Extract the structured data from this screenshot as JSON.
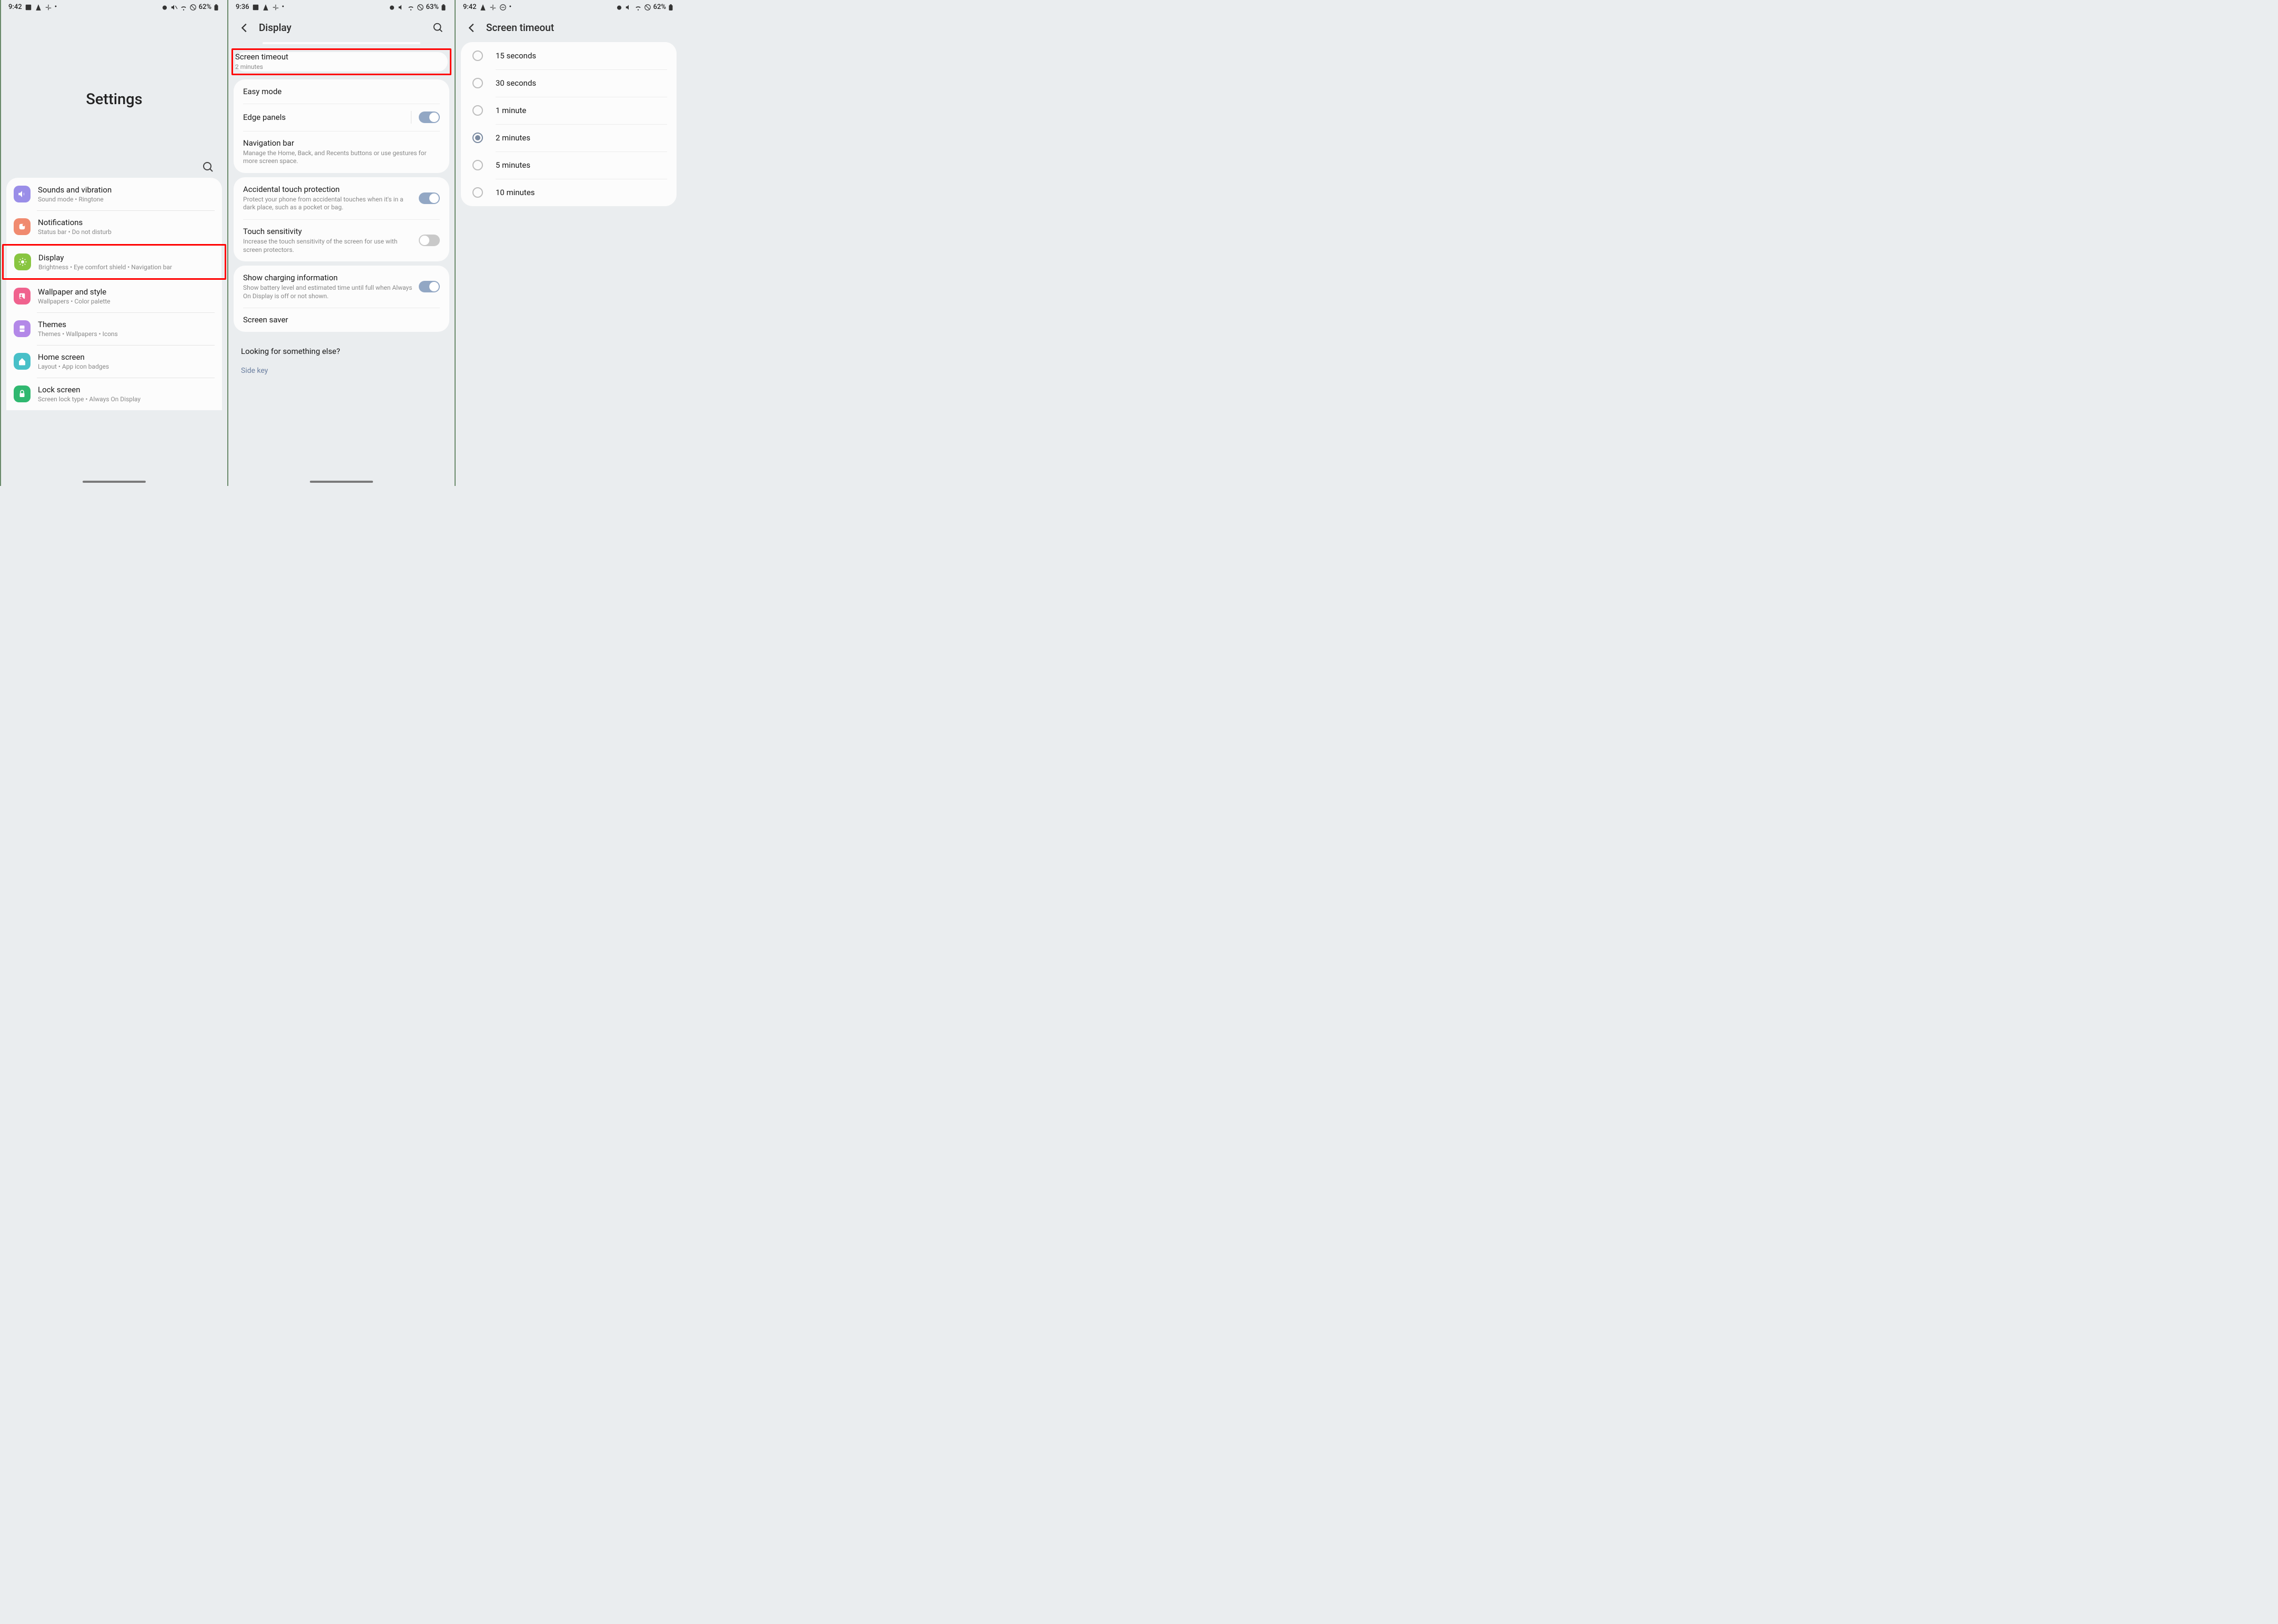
{
  "pane1": {
    "status": {
      "time": "9:42",
      "battery": "62%"
    },
    "title": "Settings",
    "rows": [
      {
        "title": "Sounds and vibration",
        "sub": "Sound mode  •  Ringtone",
        "color": "#9a8ee8"
      },
      {
        "title": "Notifications",
        "sub": "Status bar  •  Do not disturb",
        "color": "#f08a6f"
      },
      {
        "title": "Display",
        "sub": "Brightness  •  Eye comfort shield  •  Navigation bar",
        "color": "#88c540"
      },
      {
        "title": "Wallpaper and style",
        "sub": "Wallpapers  •  Color palette",
        "color": "#f0628e"
      },
      {
        "title": "Themes",
        "sub": "Themes  •  Wallpapers  •  Icons",
        "color": "#b388e8"
      },
      {
        "title": "Home screen",
        "sub": "Layout  •  App icon badges",
        "color": "#48c0c8"
      },
      {
        "title": "Lock screen",
        "sub": "Screen lock type  •  Always On Display",
        "color": "#30b870"
      }
    ]
  },
  "pane2": {
    "status": {
      "time": "9:36",
      "battery": "63%"
    },
    "title": "Display",
    "screen_timeout": {
      "title": "Screen timeout",
      "value": "2 minutes"
    },
    "group1": [
      {
        "title": "Easy mode",
        "toggle": null
      },
      {
        "title": "Edge panels",
        "toggle": true,
        "pipe": true
      },
      {
        "title": "Navigation bar",
        "sub": "Manage the Home, Back, and Recents buttons or use gestures for more screen space."
      }
    ],
    "group2": [
      {
        "title": "Accidental touch protection",
        "sub": "Protect your phone from accidental touches when it's in a dark place, such as a pocket or bag.",
        "toggle": true
      },
      {
        "title": "Touch sensitivity",
        "sub": "Increase the touch sensitivity of the screen for use with screen protectors.",
        "toggle": false
      }
    ],
    "group3": [
      {
        "title": "Show charging information",
        "sub": "Show battery level and estimated time until full when Always On Display is off or not shown.",
        "toggle": true
      },
      {
        "title": "Screen saver"
      }
    ],
    "footer": {
      "line1": "Looking for something else?",
      "line2": "Side key"
    }
  },
  "pane3": {
    "status": {
      "time": "9:42",
      "battery": "62%"
    },
    "title": "Screen timeout",
    "options": [
      {
        "label": "15 seconds",
        "selected": false
      },
      {
        "label": "30 seconds",
        "selected": false
      },
      {
        "label": "1 minute",
        "selected": false
      },
      {
        "label": "2 minutes",
        "selected": true
      },
      {
        "label": "5 minutes",
        "selected": false
      },
      {
        "label": "10 minutes",
        "selected": false
      }
    ]
  }
}
